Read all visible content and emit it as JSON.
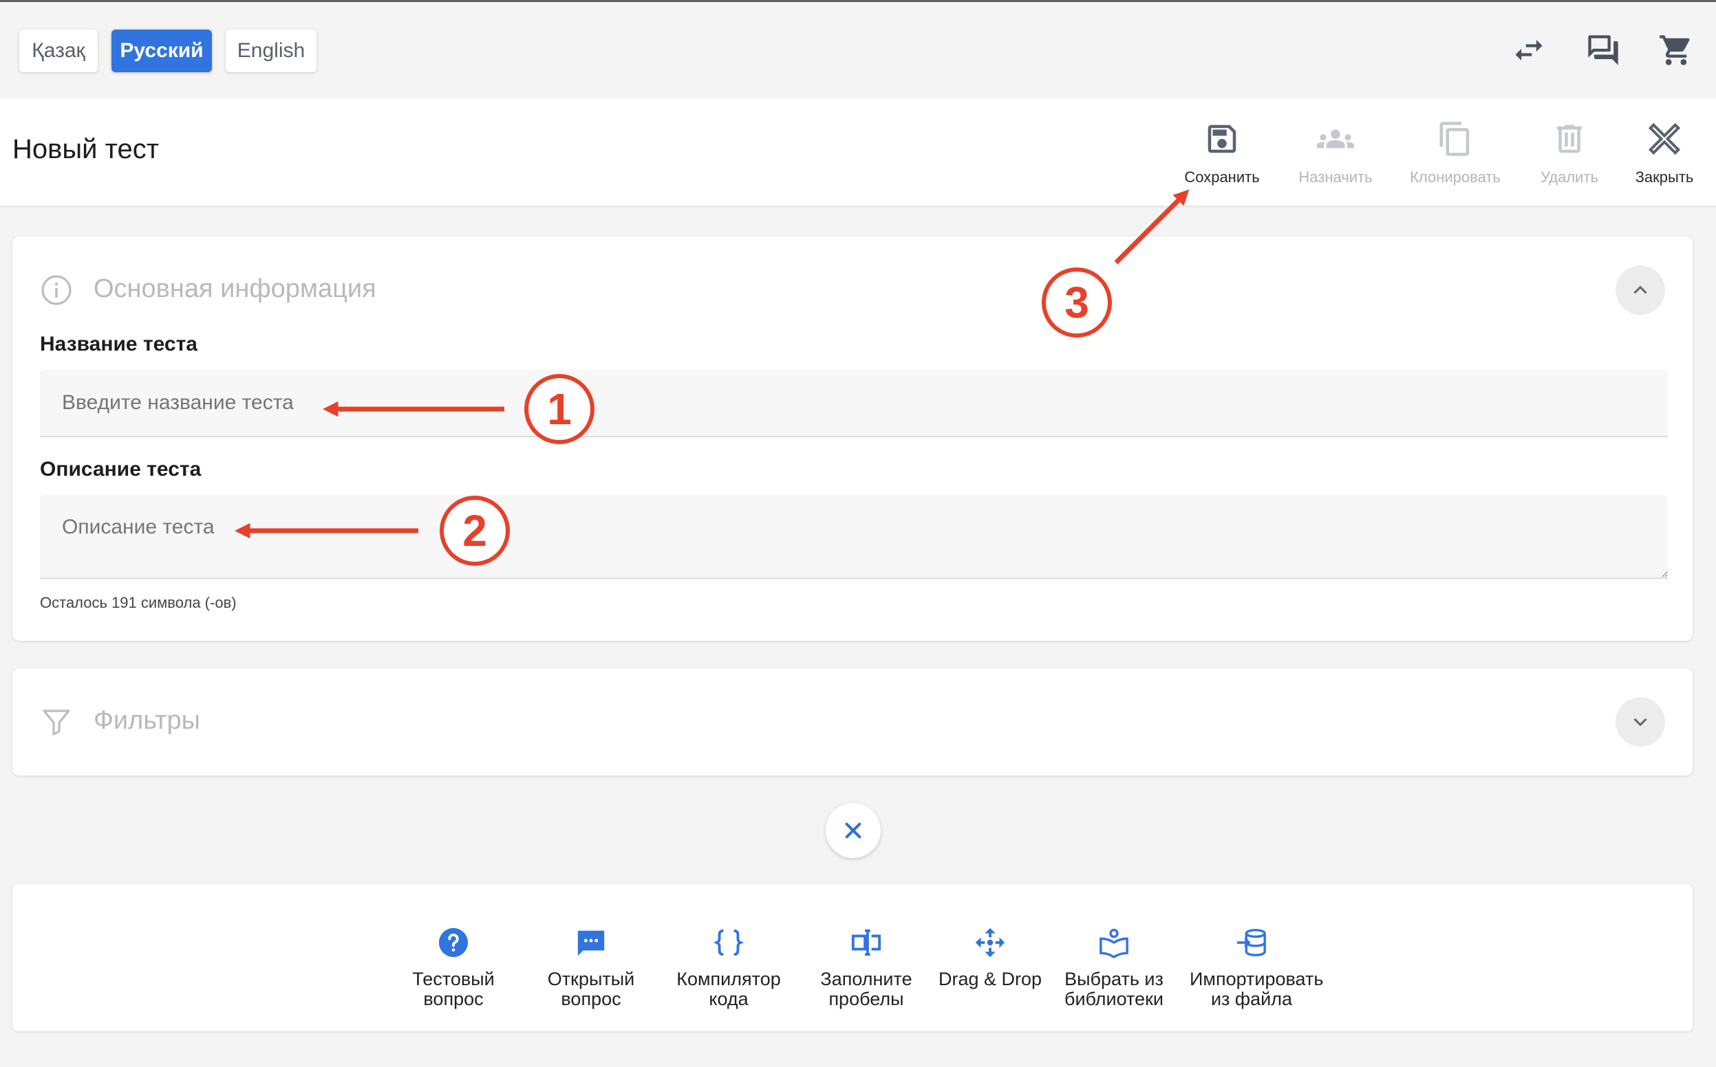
{
  "languages": [
    {
      "label": "Қазақ",
      "active": false
    },
    {
      "label": "Русский",
      "active": true
    },
    {
      "label": "English",
      "active": false
    }
  ],
  "top_icons": [
    "swap-icon",
    "chat-icon",
    "cart-icon"
  ],
  "header": {
    "title": "Новый тест",
    "toolbar": {
      "save": "Сохранить",
      "assign": "Назначить",
      "clone": "Клонировать",
      "delete": "Удалить",
      "close": "Закрыть"
    }
  },
  "basic_info": {
    "title": "Основная информация",
    "name_label": "Название теста",
    "name_placeholder": "Введите название теста",
    "name_value": "",
    "description_label": "Описание теста",
    "description_placeholder": "Описание теста",
    "description_value": "",
    "chars_left": "Осталось 191 символа (-ов)"
  },
  "filters": {
    "title": "Фильтры"
  },
  "question_types": [
    {
      "label": "Тестовый\nвопрос",
      "icon": "question-circle-icon"
    },
    {
      "label": "Открытый\nвопрос",
      "icon": "comment-dots-icon"
    },
    {
      "label": "Компилятор\nкода",
      "icon": "code-braces-icon"
    },
    {
      "label": "Заполните\nпробелы",
      "icon": "text-cursor-icon"
    },
    {
      "label": "Drag & Drop",
      "icon": "move-arrows-icon"
    },
    {
      "label": "Выбрать из\nбиблиотеки",
      "icon": "library-book-icon"
    },
    {
      "label": "Импортировать\nиз файла",
      "icon": "import-database-icon"
    }
  ],
  "annotations": [
    "1",
    "2",
    "3"
  ],
  "colors": {
    "accent": "#3174e0",
    "annotation": "#e8402a",
    "disabled": "#b5b5b5"
  }
}
